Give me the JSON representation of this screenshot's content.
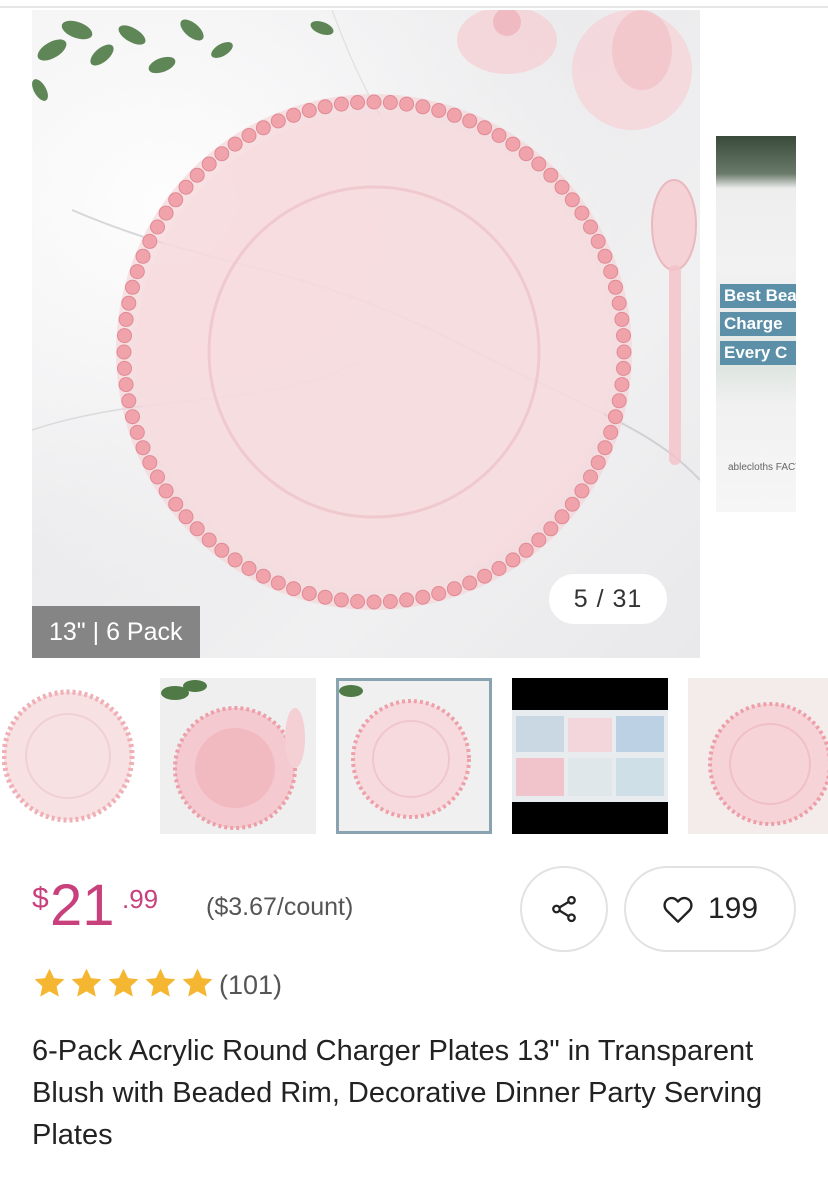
{
  "gallery": {
    "variant_label": "13\" | 6 Pack",
    "counter": "5 / 31",
    "side_banner_lines": [
      "Best Bea",
      "Charge",
      "Every C"
    ],
    "side_brand": "ablecloths FACTORY",
    "thumbnails": [
      {
        "name": "thumb-plain-plate",
        "selected": false
      },
      {
        "name": "thumb-plate-set",
        "selected": false
      },
      {
        "name": "thumb-plate-marble",
        "selected": true
      },
      {
        "name": "thumb-video",
        "selected": false
      },
      {
        "name": "thumb-plate-pink",
        "selected": false
      }
    ]
  },
  "price": {
    "symbol": "$",
    "whole": "21",
    "cents": ".99",
    "unit_price": "($3.67/count)"
  },
  "actions": {
    "share_icon": "share-icon",
    "favorite_icon": "heart-icon",
    "favorite_count": "199"
  },
  "rating": {
    "stars": 5,
    "review_count": "(101)"
  },
  "product": {
    "title": "6-Pack Acrylic Round Charger Plates 13\" in Transparent Blush with Beaded Rim, Decorative Dinner Party Serving Plates"
  },
  "colors": {
    "price": "#c8407c",
    "star": "#f5b731",
    "plate_blush": "#f1c6cc",
    "bead": "#f0a3ab"
  }
}
